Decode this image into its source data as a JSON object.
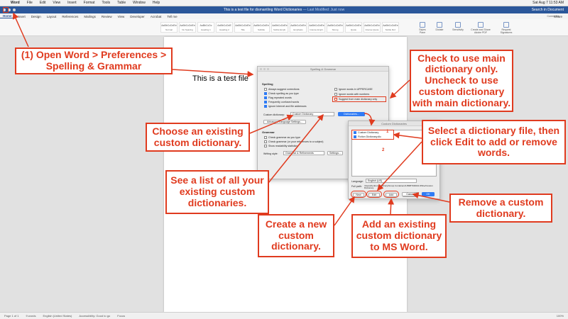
{
  "menubar": {
    "items": [
      "Word",
      "File",
      "Edit",
      "View",
      "Insert",
      "Format",
      "Tools",
      "Table",
      "Window",
      "Help"
    ],
    "clock": "Sat Aug 7  11:53 AM"
  },
  "titlebar": {
    "title": "This is a test file for dismantling Word Dictionaries",
    "saved": "— Last Modified: Just now",
    "right": "Search in Document"
  },
  "ribbon": {
    "tabs": [
      "Home",
      "Insert",
      "Design",
      "Layout",
      "References",
      "Mailings",
      "Review",
      "View",
      "Developer",
      "Acrobat",
      "Tell me"
    ],
    "share_label": "Share",
    "comments_label": "Comments",
    "styles": [
      {
        "preview": "AaBbCcDdEe",
        "label": "Normal"
      },
      {
        "preview": "AaBbCcDdEe",
        "label": "No Spacing"
      },
      {
        "preview": "AaBbCcDc",
        "label": "Heading 1"
      },
      {
        "preview": "AaBbCcDdE",
        "label": "Heading 2"
      },
      {
        "preview": "AaBbCcDdEe",
        "label": "Title"
      },
      {
        "preview": "AaBbCcDdEe",
        "label": "Subtitle"
      },
      {
        "preview": "AaBbCcDdEe",
        "label": "Subtle Emph."
      },
      {
        "preview": "AaBbCcDdEe",
        "label": "Emphasis"
      },
      {
        "preview": "AaBbCcDdEe",
        "label": "Intense Emph."
      },
      {
        "preview": "AaBbCcDdEe",
        "label": "Strong"
      },
      {
        "preview": "AaBbCcDdEe",
        "label": "Quote"
      },
      {
        "preview": "AaBbCcDdEe",
        "label": "Intense Quote"
      },
      {
        "preview": "AaBbCcDdEe",
        "label": "Subtle Ref."
      }
    ],
    "buttons": [
      "Styles Pane",
      "Dictate",
      "Sensitivity",
      "Create and Share Adobe PDF",
      "Request Signatures"
    ]
  },
  "document": {
    "text": "This is a test file"
  },
  "statusbar": {
    "page": "Page 1 of 1",
    "words": "9 words",
    "language": "English (United States)",
    "focus": "Focus",
    "accessibility": "Accessibility: Good to go",
    "zoom": "100%"
  },
  "spelling_dialog": {
    "title": "Spelling & Grammar",
    "spelling_heading": "Spelling",
    "options": [
      {
        "label": "Always suggest corrections",
        "checked": false
      },
      {
        "label": "Check spelling as you type",
        "checked": true
      },
      {
        "label": "Flag repeated words",
        "checked": true
      },
      {
        "label": "Frequently confused words",
        "checked": true
      },
      {
        "label": "Ignore Internet and file addresses",
        "checked": true
      }
    ],
    "right_options": [
      {
        "label": "Ignore words in UPPERCASE",
        "checked": false
      },
      {
        "label": "Ignore words with numbers",
        "checked": false
      },
      {
        "label": "Suggest from main dictionary only",
        "checked": false
      }
    ],
    "custom_dict_label": "Custom dictionary:",
    "custom_dict_value": "Custom Dictionary",
    "dictionaries_button": "Dictionaries...",
    "language_settings_button": "Advanced Language Settings...",
    "grammar_heading": "Grammar",
    "grammar_options": [
      {
        "label": "Check grammar as you type",
        "checked": false
      },
      {
        "label": "Check grammar (or your references to a subject)",
        "checked": false
      },
      {
        "label": "Show readability statistics",
        "checked": false
      }
    ],
    "writing_style_label": "Writing style:",
    "writing_style_value": "Grammar & Refinements",
    "settings_button": "Settings..."
  },
  "custom_dict_dialog": {
    "title": "Custom Dictionaries",
    "items": [
      {
        "label": "Custom Dictionary",
        "checked": true
      },
      {
        "label": "Fiction Dictionary.dic",
        "checked": true
      }
    ],
    "language_label": "Language:",
    "language_value": "English (US)",
    "path_label": "Full path:",
    "path_value": "/Users/benborrett/Library/Group Containers/UBF8T346G9.Office/Custom Dictionary",
    "buttons": {
      "new": "New",
      "edit": "Edit",
      "add": "Add",
      "remove": "Remove",
      "cancel": "Cancel",
      "ok": "OK"
    },
    "marker1": "1",
    "marker2": "2"
  },
  "callouts": {
    "open_word": "(1) Open Word > Preferences > Spelling & Grammar",
    "main_dictionary": "Check to use main dictionary only. Uncheck to use custom dictionary with main dictionary.",
    "choose_existing": "Choose an existing custom dictionary.",
    "select_file": "Select a dictionary file, then click Edit to add or remove words.",
    "see_list": "See a list of all your existing custom dictionaries.",
    "remove": "Remove a custom dictionary.",
    "create_new": "Create a new custom dictionary.",
    "add_existing": "Add an existing custom dictionary to MS Word."
  },
  "colors": {
    "accent": "#e03b1f",
    "word_blue": "#2b579a",
    "mac_blue": "#2f7bf5"
  }
}
